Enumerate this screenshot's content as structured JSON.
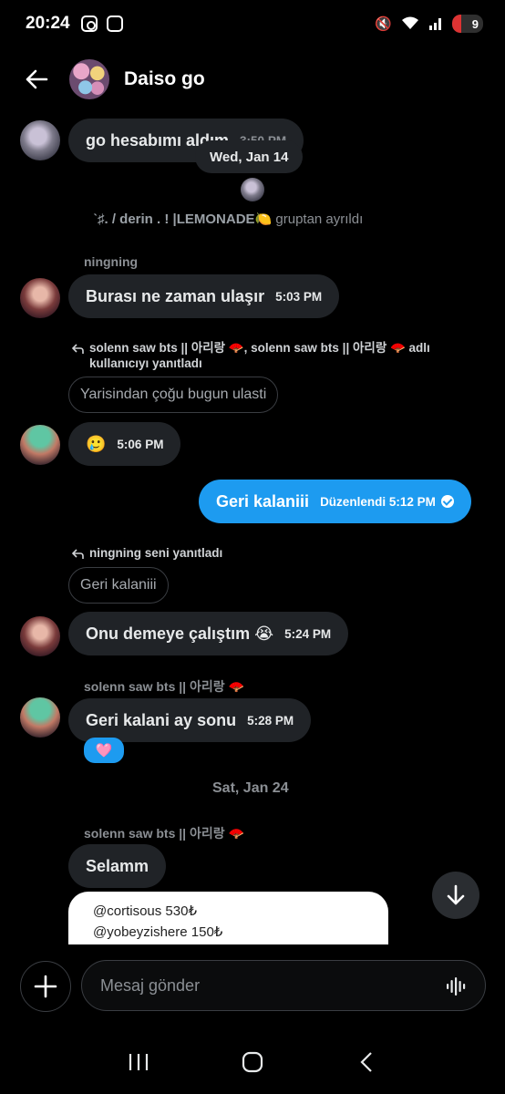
{
  "status_bar": {
    "time": "20:24",
    "battery": "9"
  },
  "header": {
    "title": "Daiso go"
  },
  "messages": {
    "m1": {
      "text": "go hesabımı aldım",
      "time": "3:50 PM"
    },
    "date1": "Wed, Jan 14",
    "system": {
      "name": "ˋ♯. / derin . ! |LEMONADE🍋",
      "text": "gruptan ayrıldı"
    },
    "sender_ningning": "ningning",
    "m2": {
      "text": "Burası ne zaman ulaşır",
      "time": "5:03 PM"
    },
    "reply1": {
      "line1": "solenn saw bts || 아리랑 🪭, solenn saw bts || 아리랑 🪭 adlı",
      "line2": "kullanıcıyı yanıtladı",
      "quote": "Yarisindan çoğu bugun ulasti"
    },
    "m3": {
      "text": "🥲",
      "time": "5:06 PM"
    },
    "m4": {
      "text": "Geri kalaniii",
      "time": "Düzenlendi 5:12 PM"
    },
    "reply2": {
      "text": "ningning seni yanıtladı",
      "quote": "Geri kalaniii"
    },
    "m5": {
      "text": "Onu demeye çalıştım 😭",
      "time": "5:24 PM"
    },
    "sender_solenn_1": "solenn saw bts || 아리랑 🪭",
    "m6": {
      "text": "Geri kalani ay sonu",
      "time": "5:28 PM",
      "reaction": "🩷"
    },
    "date2": "Sat, Jan 24",
    "sender_solenn_2": "solenn saw bts || 아리랑 🪭",
    "m7": {
      "text": "Selamm"
    },
    "card": [
      "@cortisous 530₺",
      "@yobeyzishere 150₺"
    ]
  },
  "composer": {
    "placeholder": "Mesaj gönder"
  },
  "colors": {
    "accent": "#1d9bf0",
    "bubble": "#202327",
    "background": "#000000"
  }
}
